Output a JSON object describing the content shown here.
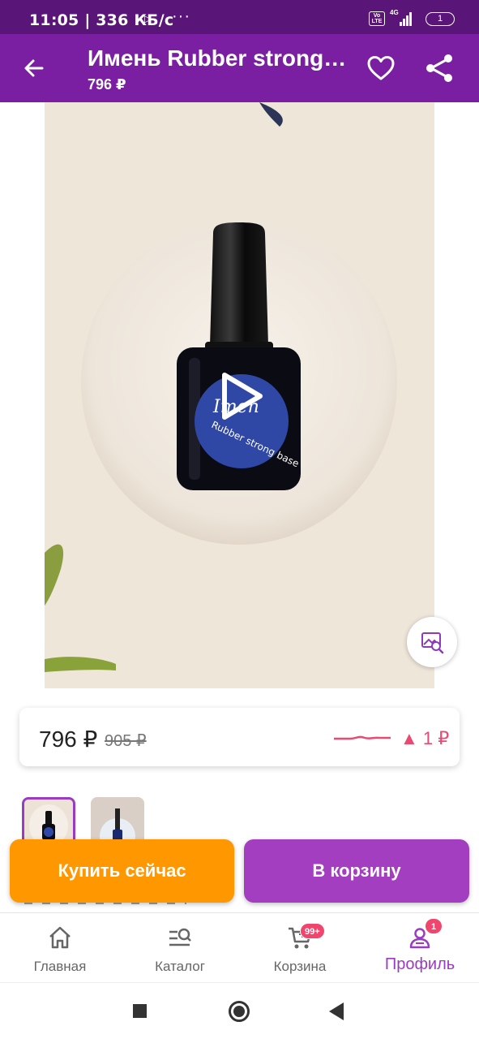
{
  "status_bar": {
    "time": "11:05",
    "speed": "| 336 КБ/с",
    "network_label": "4G",
    "volte_label": "Vo LTE",
    "battery": "1"
  },
  "app_bar": {
    "title": "Имень Rubber strong base",
    "price": "796 ₽",
    "icons": [
      "arrow-back-icon",
      "heart-icon",
      "share-icon"
    ]
  },
  "product": {
    "bottle_brand": "Imen",
    "bottle_text": "Rubber strong base",
    "media_controls": [
      "play-icon",
      "image-search-icon"
    ]
  },
  "price_card": {
    "current": "796 ₽",
    "old": "905 ₽",
    "change": "▲ 1 ₽",
    "change_color": "#e84a72"
  },
  "thumbnails": [
    {
      "selected": true
    },
    {
      "selected": false
    }
  ],
  "actions": {
    "buy_now": "Купить сейчас",
    "add_to_cart": "В корзину",
    "buy_color": "#ff9800",
    "cart_color": "#a43ec0"
  },
  "bottom_nav": {
    "items": [
      {
        "label": "Главная",
        "icon": "home-icon"
      },
      {
        "label": "Каталог",
        "icon": "catalog-search-icon"
      },
      {
        "label": "Корзина",
        "icon": "cart-icon",
        "badge": "99+"
      },
      {
        "label": "Профиль",
        "icon": "profile-icon",
        "badge": "1",
        "active": true
      }
    ],
    "active_color": "#9b3bc1"
  },
  "colors": {
    "app_bar": "#7a1fa2",
    "status_bar": "#5a1578"
  }
}
